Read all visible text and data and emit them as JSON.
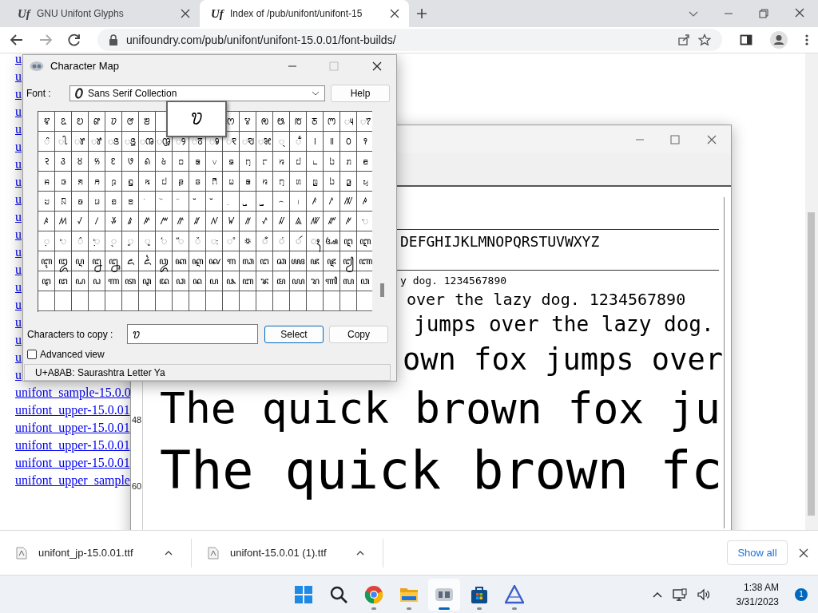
{
  "browser": {
    "tabs": [
      {
        "favicon": "Uf",
        "title": "GNU Unifont Glyphs",
        "selected": false
      },
      {
        "favicon": "Uf",
        "title": "Index of /pub/unifont/unifont-15",
        "selected": true
      }
    ],
    "address": "unifoundry.com/pub/unifont/unifont-15.0.01/font-builds/"
  },
  "page": {
    "links": [
      "u",
      "u",
      "u",
      "u",
      "u",
      "u",
      "u",
      "u",
      "u",
      "u",
      "u",
      "u",
      "u",
      "u",
      "u",
      "u",
      "u",
      "u",
      "u",
      "unifont_sample-15.0.0",
      "unifont_upper-15.0.01",
      "unifont_upper-15.0.01",
      "unifont_upper-15.0.01",
      "unifont_upper-15.0.01",
      "unifont_upper_sample"
    ]
  },
  "char_map": {
    "title": "Character Map",
    "font_label": "Font :",
    "font": "Sans Serif Collection",
    "help": "Help",
    "grid": [
      [
        "ꢢ",
        "ꢣ",
        "ꢤ",
        "ꢥ",
        "ꢦ",
        "ꢧ",
        "ꢨ",
        "ꢭ",
        "ꢮ",
        "ꢯ",
        "ꢰ",
        "ꢱ",
        "ꢲ",
        "ꢳ",
        "ꢴ",
        "ꢵ"
      ],
      [
        "ꢶ",
        "ꢷ",
        "ꢸ",
        "ꢹ",
        "ꢺ",
        "ꢻ",
        "ꢼ",
        "ꢽ",
        "ꢾ",
        "ꢿ",
        "ꣀ",
        "ꣁ",
        "ꣂ",
        "ꣃ",
        "꣄",
        "ꣅ",
        "꣎",
        "꣏",
        "꣐",
        "꣑"
      ],
      [
        "꣒",
        "꣓",
        "꣔",
        "꣕",
        "꣖",
        "꣗",
        "꣘",
        "꣙",
        "꤀",
        "꤁",
        "꤂",
        "꤃",
        "꤄",
        "꤅",
        "꤆",
        "꤇",
        "꤈",
        "꤉",
        "ꤊ",
        "ꤋ"
      ],
      [
        "ꤌ",
        "ꤍ",
        "ꤎ",
        "ꤏ",
        "ꤐ",
        "ꤑ",
        "ꤒ",
        "ꤓ",
        "ꤔ",
        "ꤕ",
        "ꤖ",
        "ꤗ",
        "ꤘ",
        "ꤙ",
        "ꤚ",
        "ꤛ",
        "ꤜ",
        "ꤝ",
        "ꤞ",
        "ꤟ"
      ],
      [
        "ꤠ",
        "ꤡ",
        "ꤢ",
        "ꤣ",
        "ꤤ",
        "ꤥ",
        "ꤦ",
        "ꤧ",
        "ꤨ",
        "ꤩ",
        "ꤪ",
        "꤫",
        "꤬",
        "꤭",
        "꤮",
        "꤯",
        "ꤰ",
        "ꤱ",
        "ꤲ",
        "ꤳ"
      ],
      [
        "ꤴ",
        "ꤵ",
        "ꤶ",
        "ꤷ",
        "ꤸ",
        "ꤹ",
        "ꤺ",
        "ꤻ",
        "ꤼ",
        "ꤽ",
        "ꤾ",
        "ꤿ",
        "ꥀ",
        "ꥁ",
        "ꥂ",
        "ꥃ",
        "ꥄ",
        "ꥅ",
        "ꥆ",
        "ꥇ"
      ],
      [
        "ꥈ",
        "ꥉ",
        "ꥊ",
        "ꥋ",
        "ꥌ",
        "ꥍ",
        "ꥎ",
        "ꥏ",
        "ꥐ",
        "ꥑ",
        "ꥒ",
        "꥓",
        "꥟",
        "ꦀ",
        "ꦁ",
        "ꦂ",
        "ꦃ",
        "ꦄ",
        "ꦅ",
        "ꦆ"
      ],
      [
        "ꦇ",
        "ꦈ",
        "ꦉ",
        "ꦊ",
        "ꦋ",
        "ꦌ",
        "ꦍ",
        "ꦎ",
        "ꦏ",
        "ꦐ",
        "ꦑ",
        "ꦒ",
        "ꦓ",
        "ꦔ",
        "ꦕ",
        "ꦖ",
        "ꦗ",
        "ꦘ",
        "ꦙ",
        "ꦚ"
      ],
      [
        "ꦛ",
        "ꦜ",
        "ꦝ",
        "ꦞ",
        "ꦟ",
        "ꦠ",
        "ꦡ",
        "ꦢ",
        "ꦣ",
        "ꦤ",
        "ꦥ",
        "ꦦ",
        "ꦧ",
        "ꦨ",
        "ꦩ",
        "ꦪ",
        "ꦫ",
        "ꦬ",
        "ꦭ",
        "ꦮ"
      ]
    ],
    "enlarged": "ꢫ",
    "copy_label": "Characters to copy :",
    "copy_value": "ꢫ",
    "select": "Select",
    "copy": "Copy",
    "advanced": {
      "label": "Advanced view",
      "checked": false
    },
    "status": "U+A8AB: Saurashtra Letter Ya"
  },
  "font_preview": {
    "size_labels": [
      "48",
      "60"
    ],
    "lines": [
      {
        "kind": "rule"
      },
      {
        "kind": "text",
        "text": "DEFGHIJKLMNOPQRSTUVWXYZ"
      },
      {
        "kind": "rule"
      },
      {
        "kind": "text",
        "text": "y dog. 1234567890"
      },
      {
        "kind": "text",
        "text": "over the lazy dog. 1234567890"
      },
      {
        "kind": "text",
        "text": "jumps over the lazy dog."
      },
      {
        "kind": "text",
        "text": "own fox jumps over"
      },
      {
        "kind": "text",
        "text": "The quick brown fox ju"
      },
      {
        "kind": "text",
        "text": "The quick brown fc"
      }
    ]
  },
  "downloads": {
    "files": [
      "unifont_jp-15.0.01.ttf",
      "unifont-15.0.01 (1).ttf"
    ],
    "show_all": "Show all"
  },
  "taskbar": {
    "apps": [
      {
        "kind": "start",
        "running": false,
        "active": false
      },
      {
        "kind": "search",
        "running": false,
        "active": false
      },
      {
        "kind": "browser",
        "running": true,
        "active": false
      },
      {
        "kind": "files",
        "running": true,
        "active": false
      },
      {
        "kind": "charmap",
        "running": true,
        "active": true
      },
      {
        "kind": "store",
        "running": true,
        "active": false
      },
      {
        "kind": "fontviewer",
        "running": true,
        "active": false
      }
    ],
    "time": "1:38 AM",
    "date": "3/31/2023",
    "notifications": "1"
  }
}
